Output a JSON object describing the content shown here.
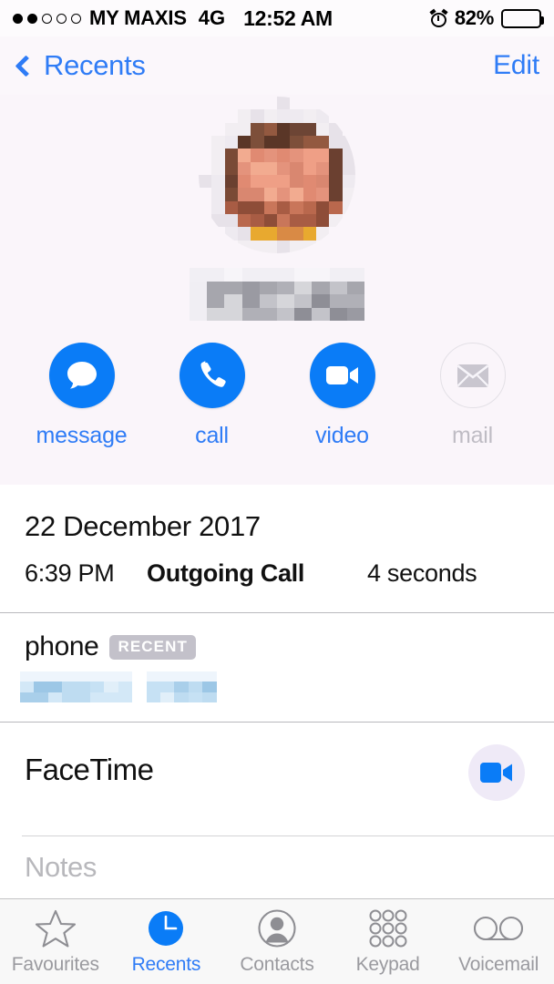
{
  "status_bar": {
    "signal_dots_total": 5,
    "signal_dots_filled": 2,
    "carrier": "MY MAXIS",
    "network": "4G",
    "time": "12:52 AM",
    "alarm_icon": "alarm-clock-icon",
    "battery_percent": "82%",
    "battery_level": 82
  },
  "nav_bar": {
    "back_label": "Recents",
    "back_icon": "chevron-left-icon",
    "edit_label": "Edit"
  },
  "header": {
    "avatar_name": "contact-avatar-redacted",
    "name_redacted": true
  },
  "actions": [
    {
      "id": "message",
      "label": "message",
      "icon": "message-bubble-icon",
      "enabled": true
    },
    {
      "id": "call",
      "label": "call",
      "icon": "phone-icon",
      "enabled": true
    },
    {
      "id": "video",
      "label": "video",
      "icon": "video-camera-icon",
      "enabled": true
    },
    {
      "id": "mail",
      "label": "mail",
      "icon": "envelope-icon",
      "enabled": false
    }
  ],
  "call_detail": {
    "date": "22 December 2017",
    "time": "6:39 PM",
    "type": "Outgoing Call",
    "duration": "4 seconds"
  },
  "phone_section": {
    "label": "phone",
    "badge": "RECENT",
    "number_redacted": true
  },
  "facetime_section": {
    "label": "FaceTime",
    "button_icon": "video-camera-icon"
  },
  "notes_section": {
    "placeholder": "Notes",
    "value": ""
  },
  "tab_bar": {
    "active": "Recents",
    "items": [
      {
        "label": "Favourites",
        "icon": "star-icon",
        "active": false
      },
      {
        "label": "Recents",
        "icon": "clock-icon",
        "active": true
      },
      {
        "label": "Contacts",
        "icon": "person-icon",
        "active": false
      },
      {
        "label": "Keypad",
        "icon": "keypad-icon",
        "active": false
      },
      {
        "label": "Voicemail",
        "icon": "voicemail-icon",
        "active": false
      }
    ]
  },
  "colors": {
    "accent_blue": "#0a7cf7",
    "link_blue": "#2f7cf6",
    "disabled_gray": "#bfbcc4",
    "badge_gray": "#c3c1ca",
    "header_tint": "#faf5fa",
    "tabbar_bg": "#f8f8f8"
  }
}
